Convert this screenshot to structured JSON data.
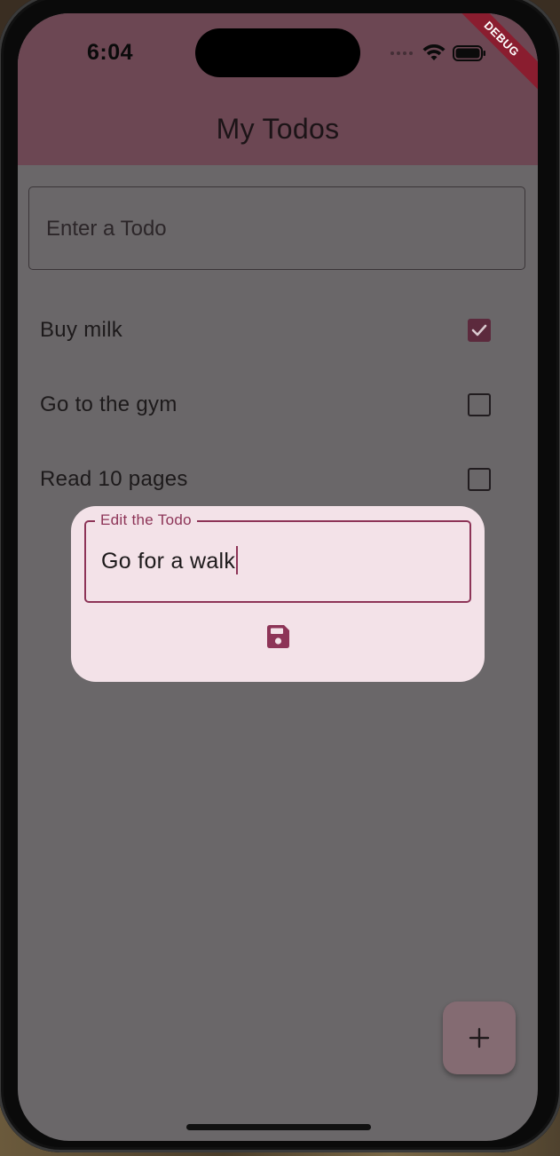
{
  "status_bar": {
    "time": "6:04",
    "icons": [
      "signal-dots-icon",
      "wifi-icon",
      "battery-icon"
    ]
  },
  "debug_banner": "DEBUG",
  "app_bar": {
    "title": "My Todos"
  },
  "todo_input": {
    "placeholder": "Enter a Todo",
    "value": ""
  },
  "todos": [
    {
      "label": "Buy milk",
      "checked": true
    },
    {
      "label": "Go to the gym",
      "checked": false
    },
    {
      "label": "Read 10 pages",
      "checked": false
    }
  ],
  "dialog": {
    "field_label": "Edit the Todo",
    "field_value": "Go for a walk",
    "save_icon": "save-icon"
  },
  "fab": {
    "icon": "plus-icon",
    "symbol": "+"
  },
  "colors": {
    "app_bar": "#6c4753",
    "scrim_background": "#6a6769",
    "dialog_background": "#f3e2e8",
    "accent": "#8d3457",
    "checked_box": "#5c2a3d",
    "fab": "#846b72"
  }
}
